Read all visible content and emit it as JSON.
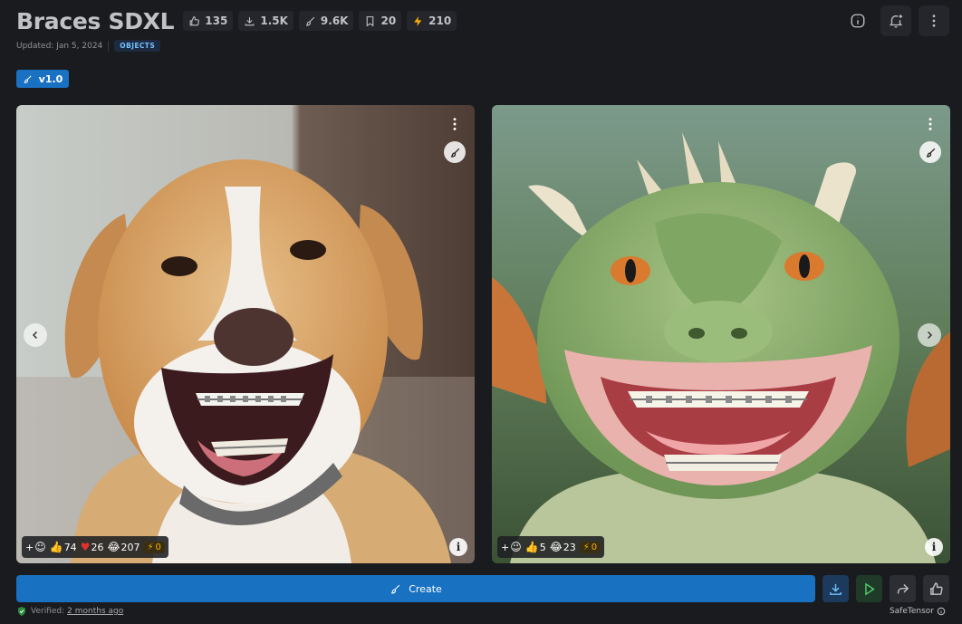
{
  "header": {
    "title": "Braces SDXL",
    "stats": [
      {
        "icon": "thumbs-up-icon",
        "value": "135"
      },
      {
        "icon": "download-icon",
        "value": "1.5K"
      },
      {
        "icon": "brush-icon",
        "value": "9.6K"
      },
      {
        "icon": "bookmark-icon",
        "value": "20"
      },
      {
        "icon": "bolt-icon",
        "value": "210"
      }
    ],
    "actions": [
      "info-icon",
      "bell-plus-icon",
      "more-vertical-icon"
    ]
  },
  "meta": {
    "updated": "Updated: Jan 5, 2024",
    "category": "OBJECTS"
  },
  "version": {
    "label": "v1.0"
  },
  "gallery": {
    "cards": [
      {
        "subject": "dog-with-braces",
        "reactions": {
          "add": "+",
          "like": "74",
          "heart": "26",
          "laugh": "207",
          "buzz": "0"
        }
      },
      {
        "subject": "dragon-with-braces",
        "reactions": {
          "add": "+",
          "like": "5",
          "laugh": "23",
          "buzz": "0"
        }
      }
    ]
  },
  "actions": {
    "create_label": "Create"
  },
  "footer": {
    "verified_label": "Verified:",
    "verified_time": "2 months ago",
    "file_format": "SafeTensor"
  },
  "colors": {
    "background": "#1a1b1e",
    "accent": "#1971c2",
    "buzz": "#fab005",
    "success": "#40c057"
  }
}
